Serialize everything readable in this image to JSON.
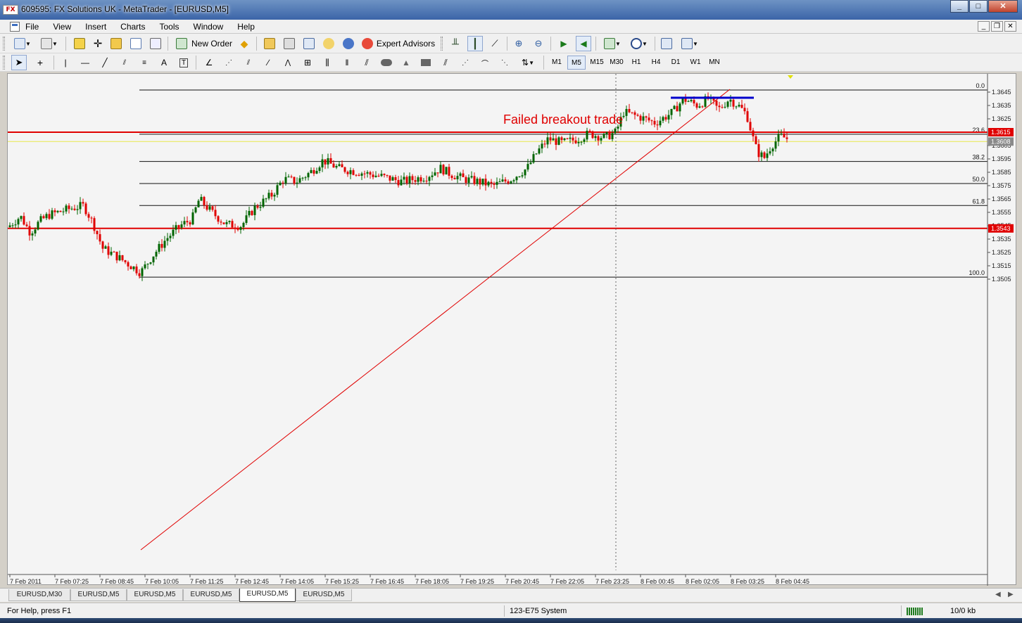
{
  "window": {
    "title": "609595: FX Solutions UK - MetaTrader - [EURUSD,M5]",
    "app_icon_text": "FX"
  },
  "menu": {
    "items": [
      "File",
      "View",
      "Insert",
      "Charts",
      "Tools",
      "Window",
      "Help"
    ]
  },
  "toolbar": {
    "new_order_label": "New Order",
    "expert_advisors_label": "Expert Advisors"
  },
  "timeframes": {
    "items": [
      "M1",
      "M5",
      "M15",
      "M30",
      "H1",
      "H4",
      "D1",
      "W1",
      "MN"
    ],
    "active": "M5"
  },
  "chart": {
    "annotation": "Failed breakout trade",
    "annotation_color": "#e00000",
    "bull_color": "#006400",
    "bear_color": "#e00000",
    "price_ticks": [
      "1.3645",
      "1.3635",
      "1.3625",
      "1.3605",
      "1.3595",
      "1.3585",
      "1.3575",
      "1.3565",
      "1.3555",
      "1.3545",
      "1.3535",
      "1.3525",
      "1.3515",
      "1.3505"
    ],
    "time_ticks": [
      "7 Feb 2011",
      "7 Feb 07:25",
      "7 Feb 08:45",
      "7 Feb 10:05",
      "7 Feb 11:25",
      "7 Feb 12:45",
      "7 Feb 14:05",
      "7 Feb 15:25",
      "7 Feb 16:45",
      "7 Feb 18:05",
      "7 Feb 19:25",
      "7 Feb 20:45",
      "7 Feb 22:05",
      "7 Feb 23:25",
      "8 Feb 00:45",
      "8 Feb 02:05",
      "8 Feb 03:25",
      "8 Feb 04:45"
    ],
    "fib_levels": [
      {
        "label": "0.0",
        "price": 1.36466
      },
      {
        "label": "23.6",
        "price": 1.36135
      },
      {
        "label": "38.2",
        "price": 1.35931
      },
      {
        "label": "50.0",
        "price": 1.35766
      },
      {
        "label": "61.8",
        "price": 1.35601
      },
      {
        "label": "100.0",
        "price": 1.35065
      }
    ],
    "resistance": {
      "price": 1.3615,
      "label": "1.3615",
      "color": "#e00000"
    },
    "support": {
      "price": 1.3543,
      "label": "1.3543",
      "color": "#e00000"
    },
    "bid": {
      "price": 1.3608,
      "label": "1.3608",
      "color": "#e8e84a"
    }
  },
  "tabs": {
    "items": [
      "EURUSD,M30",
      "EURUSD,M5",
      "EURUSD,M5",
      "EURUSD,M5",
      "EURUSD,M5",
      "EURUSD,M5"
    ],
    "active_index": 4
  },
  "status": {
    "help": "For Help, press F1",
    "profile": "123-E75 System",
    "traffic": "10/0 kb"
  }
}
